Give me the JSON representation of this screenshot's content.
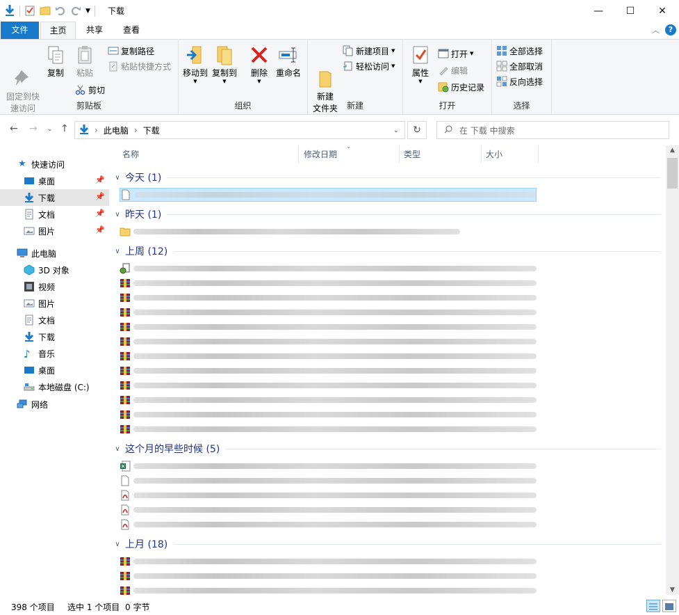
{
  "window": {
    "title": "下载",
    "controls": {
      "minimize": "—",
      "maximize": "☐",
      "close": "✕"
    }
  },
  "ribbon_tabs": [
    "文件",
    "主页",
    "共享",
    "查看"
  ],
  "ribbon": {
    "clipboard": {
      "label": "剪贴板",
      "pin_quick": "固定到快\n速访问",
      "copy": "复制",
      "paste": "粘贴",
      "copy_path": "复制路径",
      "paste_shortcut": "粘贴快捷方式",
      "cut": "剪切"
    },
    "organize": {
      "label": "组织",
      "move_to": "移动到",
      "copy_to": "复制到",
      "delete": "删除",
      "rename": "重命名"
    },
    "new": {
      "label": "新建",
      "new_folder": "新建\n文件夹",
      "new_item": "新建项目",
      "easy_access": "轻松访问"
    },
    "open": {
      "label": "打开",
      "properties": "属性",
      "open": "打开",
      "edit": "编辑",
      "history": "历史记录"
    },
    "select": {
      "label": "选择",
      "select_all": "全部选择",
      "select_none": "全部取消",
      "invert": "反向选择"
    }
  },
  "address": {
    "path": [
      "此电脑",
      "下载"
    ],
    "search_placeholder": "在 下载 中搜索"
  },
  "nav_pane": {
    "quick_access": "快速访问",
    "quick_items": [
      "桌面",
      "下载",
      "文档",
      "图片"
    ],
    "this_pc": "此电脑",
    "pc_items": [
      "3D 对象",
      "视频",
      "图片",
      "文档",
      "下载",
      "音乐",
      "桌面",
      "本地磁盘 (C:)"
    ],
    "network": "网络"
  },
  "columns": [
    "名称",
    "修改日期",
    "类型",
    "大小"
  ],
  "groups": [
    {
      "title": "今天 (1)"
    },
    {
      "title": "昨天 (1)"
    },
    {
      "title": "上周 (12)"
    },
    {
      "title": "这个月的早些时候 (5)"
    },
    {
      "title": "上月 (18)"
    }
  ],
  "status": {
    "count": "398 个项目",
    "selection": "选中 1 个项目",
    "size": "0 字节"
  },
  "colors": {
    "accent": "#1979ca",
    "group_title": "#1e3287",
    "selection_bg": "#cce8ff"
  }
}
